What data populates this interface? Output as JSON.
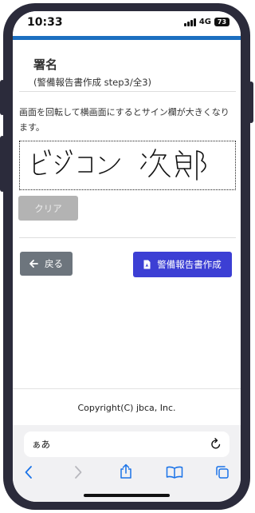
{
  "status_bar": {
    "time": "10:33",
    "network": "4G",
    "battery": "73"
  },
  "page": {
    "title": "署名",
    "subtitle": "(警備報告書作成 step3/全3)",
    "rotate_note": "画面を回転して横画面にするとサイン欄が大きくなります。",
    "signature_text": "ビジコン 次郎",
    "clear_button": "クリア",
    "back_button": "戻る",
    "create_button": "警備報告書作成",
    "copyright": "Copyright(C) jbca, Inc."
  },
  "browser": {
    "aa_label": "ぁあ",
    "icons": [
      "back-arrow-icon",
      "forward-arrow-icon",
      "share-icon",
      "bookmarks-icon",
      "tabs-icon",
      "reload-icon"
    ]
  },
  "colors": {
    "accent_bar": "#1c6fc0",
    "primary_button": "#3c3fd4",
    "secondary_button": "#6d757d",
    "disabled_button": "#b3b3b3"
  }
}
